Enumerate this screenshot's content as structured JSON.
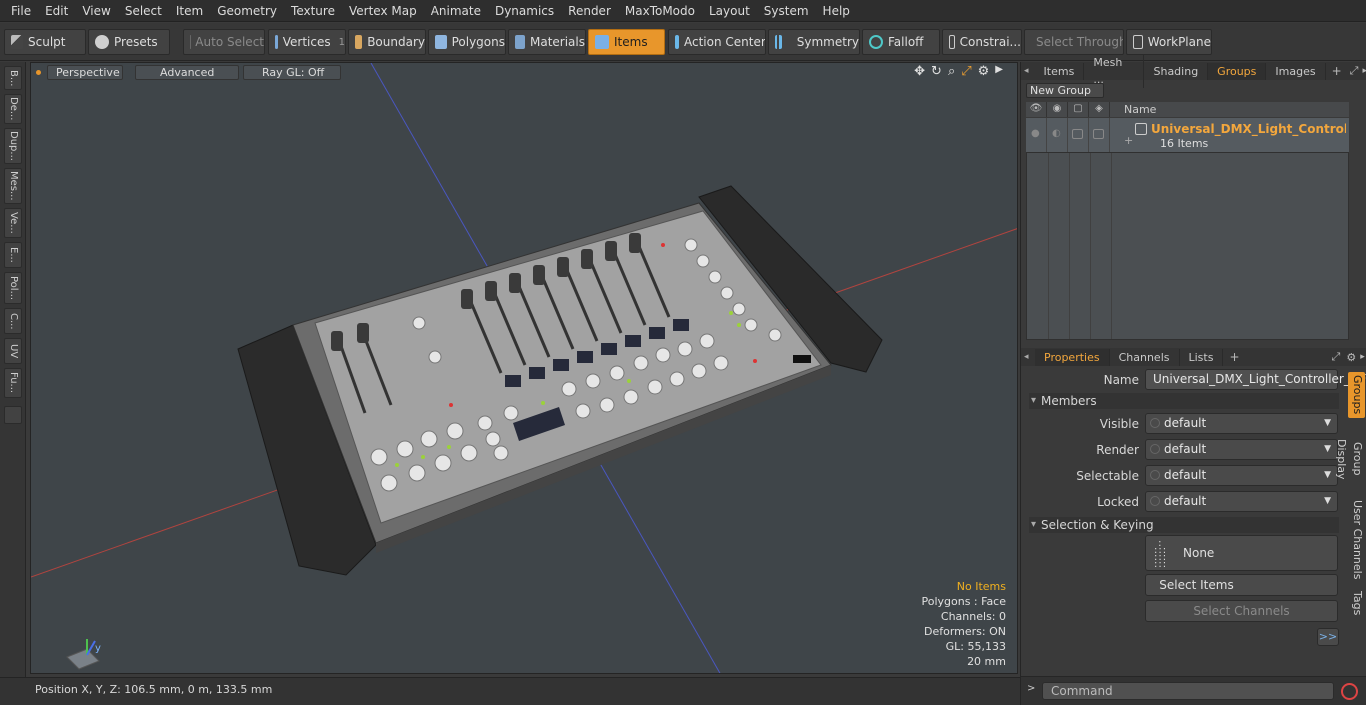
{
  "menu": [
    "File",
    "Edit",
    "View",
    "Select",
    "Item",
    "Geometry",
    "Texture",
    "Vertex Map",
    "Animate",
    "Dynamics",
    "Render",
    "MaxToModo",
    "Layout",
    "System",
    "Help"
  ],
  "toolbar": {
    "sculpt": "Sculpt",
    "presets": "Presets",
    "auto_select": "Auto Select",
    "vertices": "Vertices",
    "vertices_count": "1",
    "boundary": "Boundary",
    "polygons": "Polygons",
    "materials": "Materials",
    "items": "Items",
    "action_center": "Action Center",
    "symmetry": "Symmetry",
    "falloff": "Falloff",
    "constraints": "Constrai...",
    "select_through": "Select Through",
    "workplane": "WorkPlane"
  },
  "left_tabs": [
    "B...",
    "De...",
    "Dup...",
    "Mes...",
    "Ve...",
    "E...",
    "Pol...",
    "C...",
    "UV",
    "Fu..."
  ],
  "viewport": {
    "mode": "Perspective",
    "shading": "Advanced",
    "raygl": "Ray GL: Off",
    "stats": {
      "selection": "No Items",
      "polygons": "Polygons : Face",
      "channels": "Channels: 0",
      "deformers": "Deformers: ON",
      "gl": "GL: 55,133",
      "scale": "20 mm"
    }
  },
  "status": {
    "position": "Position X, Y, Z:  106.5 mm, 0 m, 133.5 mm"
  },
  "groups_panel": {
    "tabs": [
      "Items",
      "Mesh ...",
      "Shading",
      "Groups",
      "Images"
    ],
    "active_tab": "Groups",
    "new_group": "New Group",
    "name_header": "Name",
    "group_name": "Universal_DMX_Light_Controller...",
    "group_count": "16 Items"
  },
  "properties_panel": {
    "tabs": [
      "Properties",
      "Channels",
      "Lists"
    ],
    "name_label": "Name",
    "name_value": "Universal_DMX_Light_Controller_OFF",
    "members_section": "Members",
    "visible_label": "Visible",
    "visible_value": "default",
    "render_label": "Render",
    "render_value": "default",
    "selectable_label": "Selectable",
    "selectable_value": "default",
    "locked_label": "Locked",
    "locked_value": "default",
    "selection_section": "Selection & Keying",
    "none_label": "None",
    "select_items": "Select Items",
    "select_channels": "Select Channels",
    "more": ">>"
  },
  "side_vtabs": [
    "Groups",
    "Group Display",
    "User Channels",
    "Tags"
  ],
  "command": {
    "placeholder": "Command"
  },
  "colors": {
    "accent": "#e8962b",
    "group_name": "#f3a73d",
    "stats_warn": "#f0b020"
  }
}
